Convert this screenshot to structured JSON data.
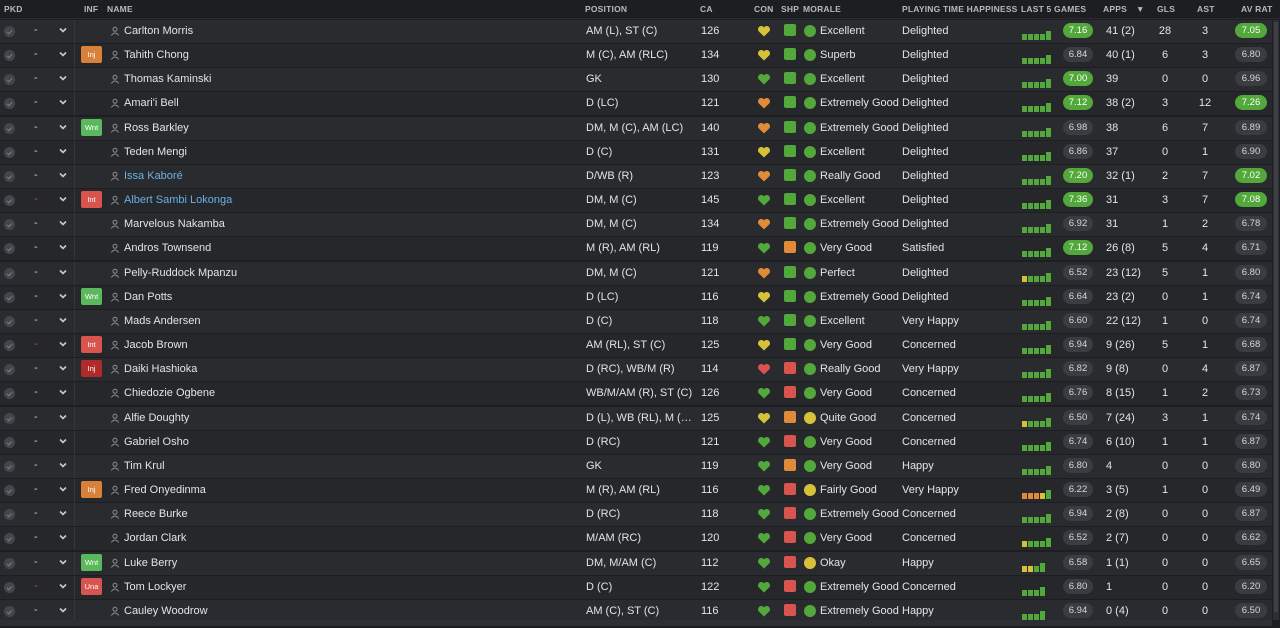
{
  "columns": {
    "pkd": "PKD",
    "inf": "INF",
    "name": "NAME",
    "position": "POSITION",
    "ca": "CA",
    "con": "CON",
    "shp": "SHP",
    "morale": "MORALE",
    "pth": "PLAYING TIME HAPPINESS",
    "last5": "LAST 5 GAMES",
    "apps": "APPS",
    "gls": "GLS",
    "ast": "AST",
    "avrat": "AV RAT",
    "sort_indicator": "▼"
  },
  "colors": {
    "green": "#52a83a",
    "orange": "#e08a3a",
    "red": "#d9534f",
    "yellow": "#d6c23a",
    "loan": "#6ab0e8"
  },
  "players": [
    {
      "name": "Carlton Morris",
      "inf": "",
      "pos": "AM (L), ST (C)",
      "ca": "126",
      "con": "yellow",
      "shp": "green",
      "morale": "Excellent",
      "mor_color": "green",
      "pth": "Delighted",
      "last5": "7.16",
      "last5_hi": true,
      "bars": [
        "g",
        "g",
        "g",
        "g",
        "g"
      ],
      "apps": "41 (2)",
      "gls": "28",
      "ast": "3",
      "avrat": "7.05",
      "avr_hi": true,
      "dash_red": false,
      "loan": false
    },
    {
      "name": "Tahith Chong",
      "inf": "Inj",
      "inf_type": "inj",
      "pos": "M (C), AM (RLC)",
      "ca": "134",
      "con": "yellow",
      "shp": "green",
      "morale": "Superb",
      "mor_color": "green",
      "pth": "Delighted",
      "last5": "6.84",
      "last5_hi": false,
      "bars": [
        "g",
        "g",
        "g",
        "g",
        "g"
      ],
      "apps": "40 (1)",
      "gls": "6",
      "ast": "3",
      "avrat": "6.80",
      "avr_hi": false,
      "dash_red": false,
      "loan": false
    },
    {
      "name": "Thomas Kaminski",
      "inf": "",
      "pos": "GK",
      "ca": "130",
      "con": "green",
      "shp": "green",
      "morale": "Excellent",
      "mor_color": "green",
      "pth": "Delighted",
      "last5": "7.00",
      "last5_hi": true,
      "bars": [
        "g",
        "g",
        "g",
        "g",
        "g"
      ],
      "apps": "39",
      "gls": "0",
      "ast": "0",
      "avrat": "6.96",
      "avr_hi": false,
      "dash_red": false,
      "loan": false
    },
    {
      "name": "Amari'i Bell",
      "inf": "",
      "pos": "D (LC)",
      "ca": "121",
      "con": "orange",
      "shp": "green",
      "morale": "Extremely Good",
      "mor_color": "green",
      "pth": "Delighted",
      "last5": "7.12",
      "last5_hi": true,
      "bars": [
        "g",
        "g",
        "g",
        "g",
        "g"
      ],
      "apps": "38 (2)",
      "gls": "3",
      "ast": "12",
      "avrat": "7.26",
      "avr_hi": true,
      "dash_red": false,
      "loan": false
    },
    {
      "name": "Ross Barkley",
      "inf": "Wnt",
      "inf_type": "wnt",
      "pos": "DM, M (C), AM (LC)",
      "ca": "140",
      "con": "orange",
      "shp": "green",
      "morale": "Extremely Good",
      "mor_color": "green",
      "pth": "Delighted",
      "last5": "6.98",
      "last5_hi": false,
      "bars": [
        "g",
        "g",
        "g",
        "g",
        "g"
      ],
      "apps": "38",
      "gls": "6",
      "ast": "7",
      "avrat": "6.89",
      "avr_hi": false,
      "dash_red": false,
      "loan": false
    },
    {
      "name": "Teden Mengi",
      "inf": "",
      "pos": "D (C)",
      "ca": "131",
      "con": "yellow",
      "shp": "green",
      "morale": "Excellent",
      "mor_color": "green",
      "pth": "Delighted",
      "last5": "6.86",
      "last5_hi": false,
      "bars": [
        "g",
        "g",
        "g",
        "g",
        "g"
      ],
      "apps": "37",
      "gls": "0",
      "ast": "1",
      "avrat": "6.90",
      "avr_hi": false,
      "dash_red": false,
      "loan": false
    },
    {
      "name": "Issa Kaboré",
      "inf": "",
      "pos": "D/WB (R)",
      "ca": "123",
      "con": "orange",
      "shp": "green",
      "morale": "Really Good",
      "mor_color": "green",
      "pth": "Delighted",
      "last5": "7.20",
      "last5_hi": true,
      "bars": [
        "g",
        "g",
        "g",
        "g",
        "g"
      ],
      "apps": "32 (1)",
      "gls": "2",
      "ast": "7",
      "avrat": "7.02",
      "avr_hi": true,
      "dash_red": false,
      "loan": true
    },
    {
      "name": "Albert Sambi Lokonga",
      "inf": "Int",
      "inf_type": "int",
      "pos": "DM, M (C)",
      "ca": "145",
      "con": "green",
      "shp": "green",
      "morale": "Excellent",
      "mor_color": "green",
      "pth": "Delighted",
      "last5": "7.36",
      "last5_hi": true,
      "bars": [
        "g",
        "g",
        "g",
        "g",
        "g"
      ],
      "apps": "31",
      "gls": "3",
      "ast": "7",
      "avrat": "7.08",
      "avr_hi": true,
      "dash_red": true,
      "loan": true
    },
    {
      "name": "Marvelous Nakamba",
      "inf": "",
      "pos": "DM, M (C)",
      "ca": "134",
      "con": "orange",
      "shp": "green",
      "morale": "Extremely Good",
      "mor_color": "green",
      "pth": "Delighted",
      "last5": "6.92",
      "last5_hi": false,
      "bars": [
        "g",
        "g",
        "g",
        "g",
        "g"
      ],
      "apps": "31",
      "gls": "1",
      "ast": "2",
      "avrat": "6.78",
      "avr_hi": false,
      "dash_red": false,
      "loan": false
    },
    {
      "name": "Andros Townsend",
      "inf": "",
      "pos": "M (R), AM (RL)",
      "ca": "119",
      "con": "green",
      "shp": "orange",
      "morale": "Very Good",
      "mor_color": "green",
      "pth": "Satisfied",
      "last5": "7.12",
      "last5_hi": true,
      "bars": [
        "g",
        "g",
        "g",
        "g",
        "g"
      ],
      "apps": "26 (8)",
      "gls": "5",
      "ast": "4",
      "avrat": "6.71",
      "avr_hi": false,
      "dash_red": false,
      "loan": false
    },
    {
      "name": "Pelly-Ruddock Mpanzu",
      "inf": "",
      "pos": "DM, M (C)",
      "ca": "121",
      "con": "orange",
      "shp": "green",
      "morale": "Perfect",
      "mor_color": "green",
      "pth": "Delighted",
      "last5": "6.52",
      "last5_hi": false,
      "bars": [
        "y",
        "g",
        "g",
        "g",
        "g"
      ],
      "apps": "23 (12)",
      "gls": "5",
      "ast": "1",
      "avrat": "6.80",
      "avr_hi": false,
      "dash_red": false,
      "loan": false
    },
    {
      "name": "Dan Potts",
      "inf": "Wnt",
      "inf_type": "wnt",
      "pos": "D (LC)",
      "ca": "116",
      "con": "yellow",
      "shp": "green",
      "morale": "Extremely Good",
      "mor_color": "green",
      "pth": "Delighted",
      "last5": "6.64",
      "last5_hi": false,
      "bars": [
        "g",
        "g",
        "g",
        "g",
        "g"
      ],
      "apps": "23 (2)",
      "gls": "0",
      "ast": "1",
      "avrat": "6.74",
      "avr_hi": false,
      "dash_red": false,
      "loan": false
    },
    {
      "name": "Mads Andersen",
      "inf": "",
      "pos": "D (C)",
      "ca": "118",
      "con": "green",
      "shp": "green",
      "morale": "Excellent",
      "mor_color": "green",
      "pth": "Very Happy",
      "last5": "6.60",
      "last5_hi": false,
      "bars": [
        "g",
        "g",
        "g",
        "g",
        "g"
      ],
      "apps": "22 (12)",
      "gls": "1",
      "ast": "0",
      "avrat": "6.74",
      "avr_hi": false,
      "dash_red": false,
      "loan": false
    },
    {
      "name": "Jacob Brown",
      "inf": "Int",
      "inf_type": "int",
      "pos": "AM (RL), ST (C)",
      "ca": "125",
      "con": "yellow",
      "shp": "green",
      "morale": "Very Good",
      "mor_color": "green",
      "pth": "Concerned",
      "last5": "6.94",
      "last5_hi": false,
      "bars": [
        "g",
        "g",
        "g",
        "g",
        "g"
      ],
      "apps": "9 (26)",
      "gls": "5",
      "ast": "1",
      "avrat": "6.68",
      "avr_hi": false,
      "dash_red": true,
      "loan": false
    },
    {
      "name": "Daiki Hashioka",
      "inf": "Inj",
      "inf_type": "injr",
      "pos": "D (RC), WB/M (R)",
      "ca": "114",
      "con": "red",
      "shp": "red",
      "morale": "Really Good",
      "mor_color": "green",
      "pth": "Very Happy",
      "last5": "6.82",
      "last5_hi": false,
      "bars": [
        "g",
        "g",
        "g",
        "g",
        "g"
      ],
      "apps": "9 (8)",
      "gls": "0",
      "ast": "4",
      "avrat": "6.87",
      "avr_hi": false,
      "dash_red": false,
      "loan": false
    },
    {
      "name": "Chiedozie Ogbene",
      "inf": "",
      "pos": "WB/M/AM (R), ST (C)",
      "ca": "126",
      "con": "green",
      "shp": "red",
      "morale": "Very Good",
      "mor_color": "green",
      "pth": "Concerned",
      "last5": "6.76",
      "last5_hi": false,
      "bars": [
        "g",
        "g",
        "g",
        "g",
        "g"
      ],
      "apps": "8 (15)",
      "gls": "1",
      "ast": "2",
      "avrat": "6.73",
      "avr_hi": false,
      "dash_red": false,
      "loan": false
    },
    {
      "name": "Alfie Doughty",
      "inf": "",
      "pos": "D (L), WB (RL), M (L), AM (L)",
      "ca": "125",
      "con": "yellow",
      "shp": "orange",
      "morale": "Quite Good",
      "mor_color": "yellow",
      "pth": "Concerned",
      "last5": "6.50",
      "last5_hi": false,
      "bars": [
        "y",
        "g",
        "g",
        "g",
        "g"
      ],
      "apps": "7 (24)",
      "gls": "3",
      "ast": "1",
      "avrat": "6.74",
      "avr_hi": false,
      "dash_red": false,
      "loan": false
    },
    {
      "name": "Gabriel Osho",
      "inf": "",
      "pos": "D (RC)",
      "ca": "121",
      "con": "green",
      "shp": "red",
      "morale": "Very Good",
      "mor_color": "green",
      "pth": "Concerned",
      "last5": "6.74",
      "last5_hi": false,
      "bars": [
        "g",
        "g",
        "g",
        "g",
        "g"
      ],
      "apps": "6 (10)",
      "gls": "1",
      "ast": "1",
      "avrat": "6.87",
      "avr_hi": false,
      "dash_red": false,
      "loan": false
    },
    {
      "name": "Tim Krul",
      "inf": "",
      "pos": "GK",
      "ca": "119",
      "con": "green",
      "shp": "orange",
      "morale": "Very Good",
      "mor_color": "green",
      "pth": "Happy",
      "last5": "6.80",
      "last5_hi": false,
      "bars": [
        "g",
        "g",
        "g",
        "g",
        "g"
      ],
      "apps": "4",
      "gls": "0",
      "ast": "0",
      "avrat": "6.80",
      "avr_hi": false,
      "dash_red": false,
      "loan": false
    },
    {
      "name": "Fred Onyedinma",
      "inf": "Inj",
      "inf_type": "inj",
      "pos": "M (R), AM (RL)",
      "ca": "116",
      "con": "green",
      "shp": "red",
      "morale": "Fairly Good",
      "mor_color": "yellow",
      "pth": "Very Happy",
      "last5": "6.22",
      "last5_hi": false,
      "bars": [
        "o",
        "o",
        "o",
        "y",
        "g"
      ],
      "apps": "3 (5)",
      "gls": "1",
      "ast": "0",
      "avrat": "6.49",
      "avr_hi": false,
      "dash_red": false,
      "loan": false
    },
    {
      "name": "Reece Burke",
      "inf": "",
      "pos": "D (RC)",
      "ca": "118",
      "con": "green",
      "shp": "red",
      "morale": "Extremely Good",
      "mor_color": "green",
      "pth": "Concerned",
      "last5": "6.94",
      "last5_hi": false,
      "bars": [
        "g",
        "g",
        "g",
        "g",
        "g"
      ],
      "apps": "2 (8)",
      "gls": "0",
      "ast": "0",
      "avrat": "6.87",
      "avr_hi": false,
      "dash_red": false,
      "loan": false
    },
    {
      "name": "Jordan Clark",
      "inf": "",
      "pos": "M/AM (RC)",
      "ca": "120",
      "con": "green",
      "shp": "red",
      "morale": "Very Good",
      "mor_color": "green",
      "pth": "Concerned",
      "last5": "6.52",
      "last5_hi": false,
      "bars": [
        "y",
        "g",
        "g",
        "g",
        "g"
      ],
      "apps": "2 (7)",
      "gls": "0",
      "ast": "0",
      "avrat": "6.62",
      "avr_hi": false,
      "dash_red": false,
      "loan": false
    },
    {
      "name": "Luke Berry",
      "inf": "Wnt",
      "inf_type": "wnt",
      "pos": "DM, M/AM (C)",
      "ca": "112",
      "con": "green",
      "shp": "red",
      "morale": "Okay",
      "mor_color": "yellow",
      "pth": "Happy",
      "last5": "6.58",
      "last5_hi": false,
      "bars": [
        "y",
        "y",
        "g",
        "g"
      ],
      "apps": "1 (1)",
      "gls": "0",
      "ast": "0",
      "avrat": "6.65",
      "avr_hi": false,
      "dash_red": false,
      "loan": false
    },
    {
      "name": "Tom Lockyer",
      "inf": "Una",
      "inf_type": "una",
      "pos": "D (C)",
      "ca": "122",
      "con": "green",
      "shp": "red",
      "morale": "Extremely Good",
      "mor_color": "green",
      "pth": "Concerned",
      "last5": "6.80",
      "last5_hi": false,
      "bars": [
        "g",
        "g",
        "g",
        "g"
      ],
      "apps": "1",
      "gls": "0",
      "ast": "0",
      "avrat": "6.20",
      "avr_hi": false,
      "dash_red": true,
      "loan": false
    },
    {
      "name": "Cauley Woodrow",
      "inf": "",
      "pos": "AM (C), ST (C)",
      "ca": "116",
      "con": "green",
      "shp": "red",
      "morale": "Extremely Good",
      "mor_color": "green",
      "pth": "Happy",
      "last5": "6.94",
      "last5_hi": false,
      "bars": [
        "g",
        "g",
        "g",
        "g"
      ],
      "apps": "0 (4)",
      "gls": "0",
      "ast": "0",
      "avrat": "6.50",
      "avr_hi": false,
      "dash_red": false,
      "loan": false
    }
  ]
}
